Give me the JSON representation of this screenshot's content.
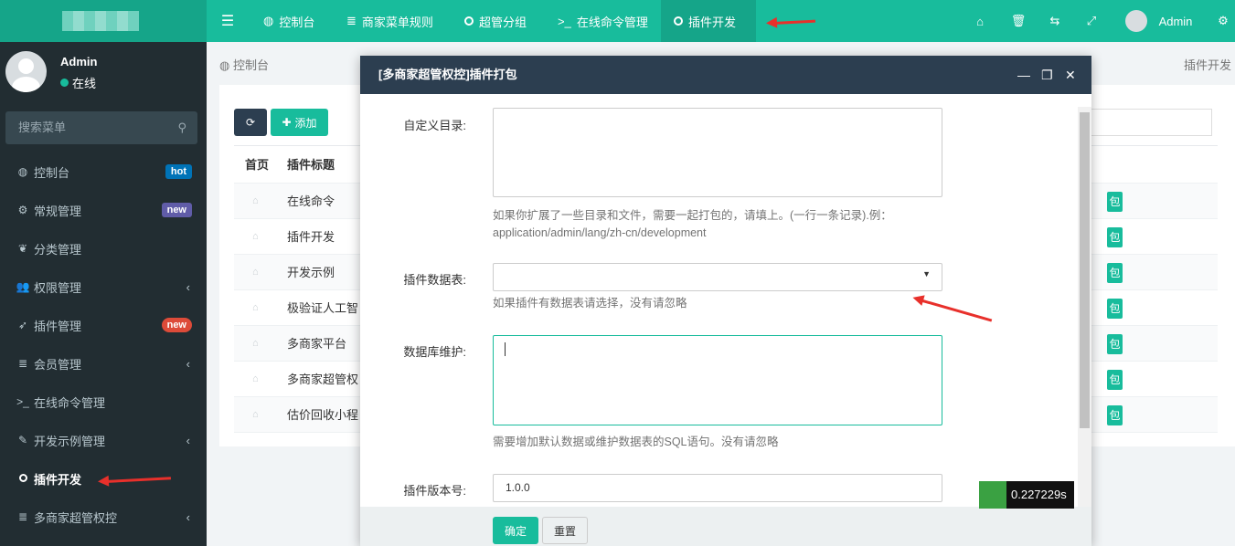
{
  "topbar": {
    "nav": [
      {
        "icon": "dashboard-icon",
        "label": "控制台"
      },
      {
        "icon": "list-icon",
        "label": "商家菜单规则"
      },
      {
        "icon": "circle-icon",
        "label": "超管分组"
      },
      {
        "icon": "terminal-icon",
        "label": "在线命令管理"
      },
      {
        "icon": "circle-icon",
        "label": "插件开发"
      }
    ],
    "user": "Admin"
  },
  "sidebar": {
    "user_name": "Admin",
    "status": "在线",
    "search_placeholder": "搜索菜单",
    "items": [
      {
        "icon": "dashboard-icon",
        "label": "控制台",
        "badge": "hot",
        "badge_color": "#0073b7"
      },
      {
        "icon": "cogs-icon",
        "label": "常规管理",
        "badge": "new",
        "badge_color": "#605ca8"
      },
      {
        "icon": "leaf-icon",
        "label": "分类管理"
      },
      {
        "icon": "users-icon",
        "label": "权限管理",
        "expandable": true
      },
      {
        "icon": "rocket-icon",
        "label": "插件管理",
        "badge": "new",
        "badge_color": "#dd4b39"
      },
      {
        "icon": "list-icon",
        "label": "会员管理",
        "expandable": true
      },
      {
        "icon": "terminal-icon",
        "label": "在线命令管理"
      },
      {
        "icon": "magic-icon",
        "label": "开发示例管理",
        "expandable": true
      },
      {
        "icon": "circle-icon",
        "label": "插件开发",
        "active": true
      },
      {
        "icon": "list-icon",
        "label": "多商家超管权控",
        "expandable": true
      }
    ]
  },
  "breadcrumb": {
    "left": "控制台",
    "right": "插件开发"
  },
  "toolbar": {
    "add_label": "添加"
  },
  "table": {
    "headers": [
      "首页",
      "插件标题"
    ],
    "rows": [
      "在线命令",
      "插件开发",
      "开发示例",
      "极验证人工智",
      "多商家平台",
      "多商家超管权",
      "估价回收小程"
    ],
    "action_label": "包"
  },
  "modal": {
    "title": "[多商家超管权控]插件打包",
    "fields": {
      "custom_dir_label": "自定义目录:",
      "custom_dir_help": "如果你扩展了一些目录和文件，需要一起打包的，请填上。(一行一条记录).例：",
      "custom_dir_example": "application/admin/lang/zh-cn/development",
      "tables_label": "插件数据表:",
      "tables_help": "如果插件有数据表请选择，没有请忽略",
      "db_label": "数据库维护:",
      "db_help": "需要增加默认数据或维护数据表的SQL语句。没有请忽略",
      "version_label": "插件版本号:",
      "version_value": "1.0.0"
    },
    "confirm": "确定",
    "reset": "重置"
  },
  "perf": "0.227229s",
  "colors": {
    "primary": "#18bc9c",
    "sidebar": "#222d32",
    "modal_header": "#2c3e50"
  }
}
